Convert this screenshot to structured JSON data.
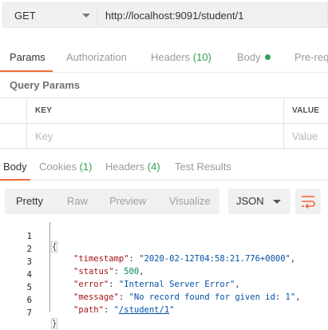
{
  "request": {
    "method": "GET",
    "url": "http://localhost:9091/student/1"
  },
  "request_tabs": [
    {
      "label": "Params"
    },
    {
      "label": "Authorization"
    },
    {
      "label": "Headers",
      "count": "(10)"
    },
    {
      "label": "Body"
    },
    {
      "label": "Pre-req"
    }
  ],
  "query_params": {
    "title": "Query Params",
    "key_header": "KEY",
    "value_header": "VALUE",
    "key_placeholder": "Key",
    "value_placeholder": "Value"
  },
  "response_tabs": [
    {
      "label": "Body"
    },
    {
      "label": "Cookies",
      "count": "(1)"
    },
    {
      "label": "Headers",
      "count": "(4)"
    },
    {
      "label": "Test Results"
    }
  ],
  "view_modes": [
    "Pretty",
    "Raw",
    "Preview",
    "Visualize"
  ],
  "format": "JSON",
  "code_lines": [
    {
      "n": "1",
      "open": "{"
    },
    {
      "n": "2",
      "key": "\"timestamp\"",
      "value": "\"2020-02-12T04:58:21.776+0000\"",
      "tail": ","
    },
    {
      "n": "3",
      "key": "\"status\"",
      "value": "500",
      "tail": ","
    },
    {
      "n": "4",
      "key": "\"error\"",
      "value": "\"Internal Server Error\"",
      "tail": ","
    },
    {
      "n": "5",
      "key": "\"message\"",
      "value": "\"No record found for given id: 1\"",
      "tail": ","
    },
    {
      "n": "6",
      "key": "\"path\"",
      "value_q1": "\"",
      "value_link": "/student/1",
      "value_q2": "\""
    },
    {
      "n": "7",
      "close": "}"
    }
  ],
  "colors": {
    "accent": "#f26b3a",
    "count_green": "#30a14e"
  },
  "icons": [
    "chevron-down-icon",
    "status-dot-icon",
    "wrap-lines-icon"
  ]
}
